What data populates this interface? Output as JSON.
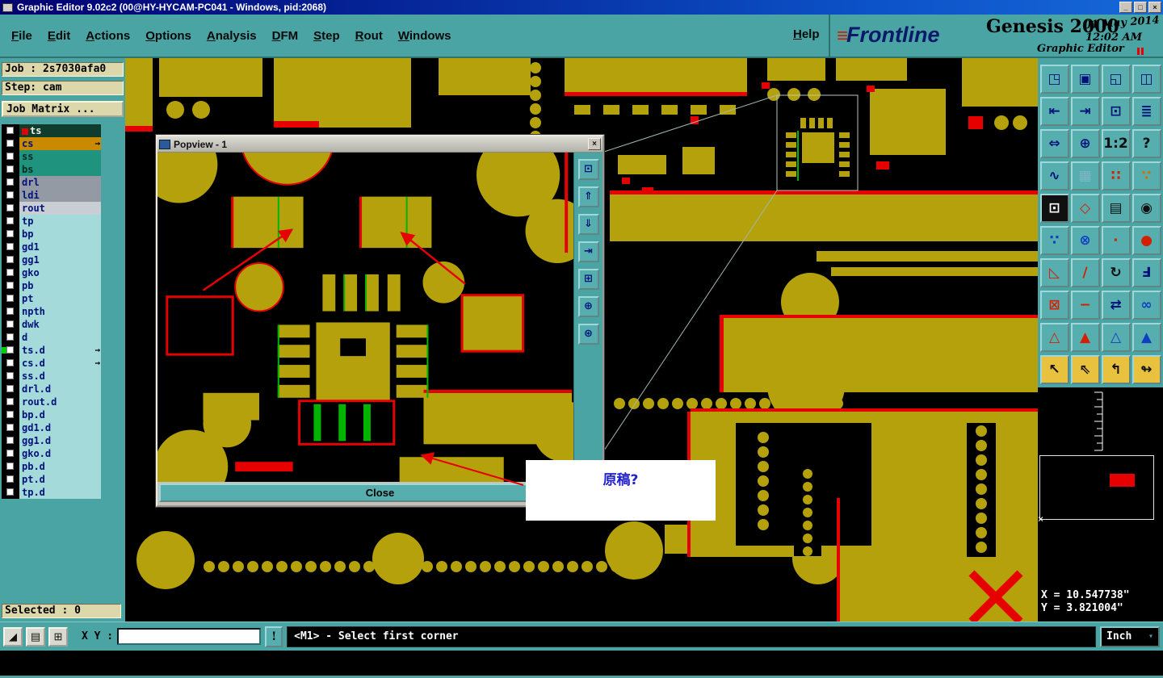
{
  "titlebar": {
    "title": "Graphic Editor 9.02c2 (00@HY-HYCAM-PC041 - Windows, pid:2068)",
    "minimize": "_",
    "maximize": "□",
    "close": "×"
  },
  "menubar": {
    "items": [
      "File",
      "Edit",
      "Actions",
      "Options",
      "Analysis",
      "DFM",
      "Step",
      "Rout",
      "Windows"
    ],
    "help": "Help"
  },
  "brand": {
    "logo_mark": "≡",
    "logo": "Frontline",
    "product": "Genesis 2000",
    "date": "01 May 2014",
    "time": "12:02 AM",
    "subtitle": "Graphic Editor"
  },
  "left_panel": {
    "job": "Job : 2s7030afa0",
    "step": "Step: cam",
    "matrix_button": "Job Matrix ...",
    "selected": "Selected : 0",
    "layers": [
      {
        "name": "ts",
        "bg": "#0e3d2e",
        "fg": "#f0f0e0",
        "swatch": "#e60000"
      },
      {
        "name": "cs",
        "bg": "#c98a00",
        "fg": "#00127a",
        "arrow": "→"
      },
      {
        "name": "ss",
        "bg": "#20937f",
        "fg": "#002a20"
      },
      {
        "name": "bs",
        "bg": "#20937f",
        "fg": "#002a20"
      },
      {
        "name": "drl",
        "bg": "#939aa4",
        "fg": "#00127a"
      },
      {
        "name": "ldi",
        "bg": "#939aa4",
        "fg": "#00127a"
      },
      {
        "name": "rout",
        "bg": "#c9ced4",
        "fg": "#00127a"
      },
      {
        "name": "tp",
        "bg": "#a5dada",
        "fg": "#00127a"
      },
      {
        "name": "bp",
        "bg": "#a5dada",
        "fg": "#00127a"
      },
      {
        "name": "gd1",
        "bg": "#a5dada",
        "fg": "#00127a"
      },
      {
        "name": "gg1",
        "bg": "#a5dada",
        "fg": "#00127a"
      },
      {
        "name": "gko",
        "bg": "#a5dada",
        "fg": "#00127a"
      },
      {
        "name": "pb",
        "bg": "#a5dada",
        "fg": "#00127a"
      },
      {
        "name": "pt",
        "bg": "#a5dada",
        "fg": "#00127a"
      },
      {
        "name": "npth",
        "bg": "#a5dada",
        "fg": "#00127a"
      },
      {
        "name": "dwk",
        "bg": "#a5dada",
        "fg": "#00127a"
      },
      {
        "name": "d",
        "bg": "#a5dada",
        "fg": "#00127a"
      },
      {
        "name": "ts.d",
        "bg": "#a5dada",
        "fg": "#00127a",
        "marker": "#00cc00",
        "arrow": "→"
      },
      {
        "name": "cs.d",
        "bg": "#a5dada",
        "fg": "#00127a",
        "arrow": "→"
      },
      {
        "name": "ss.d",
        "bg": "#a5dada",
        "fg": "#00127a"
      },
      {
        "name": "drl.d",
        "bg": "#a5dada",
        "fg": "#00127a"
      },
      {
        "name": "rout.d",
        "bg": "#a5dada",
        "fg": "#00127a"
      },
      {
        "name": "bp.d",
        "bg": "#a5dada",
        "fg": "#00127a"
      },
      {
        "name": "gd1.d",
        "bg": "#a5dada",
        "fg": "#00127a"
      },
      {
        "name": "gg1.d",
        "bg": "#a5dada",
        "fg": "#00127a"
      },
      {
        "name": "gko.d",
        "bg": "#a5dada",
        "fg": "#00127a"
      },
      {
        "name": "pb.d",
        "bg": "#a5dada",
        "fg": "#00127a"
      },
      {
        "name": "pt.d",
        "bg": "#a5dada",
        "fg": "#00127a"
      },
      {
        "name": "tp.d",
        "bg": "#a5dada",
        "fg": "#00127a"
      }
    ]
  },
  "right_toolbar": {
    "buttons": [
      {
        "name": "open-window-icon",
        "glyph": "◳",
        "color": "#00127a"
      },
      {
        "name": "monitor-icon",
        "glyph": "▣",
        "color": "#00127a"
      },
      {
        "name": "window-corner-icon",
        "glyph": "◱",
        "color": "#00127a"
      },
      {
        "name": "split-window-icon",
        "glyph": "◫",
        "color": "#00127a"
      },
      {
        "name": "pan-left-icon",
        "glyph": "⇤",
        "color": "#00127a"
      },
      {
        "name": "pan-right-icon",
        "glyph": "⇥",
        "color": "#00127a"
      },
      {
        "name": "zoom-window-icon",
        "glyph": "⊡",
        "color": "#00127a"
      },
      {
        "name": "layers-stack-icon",
        "glyph": "≣",
        "color": "#00127a"
      },
      {
        "name": "zoom-fit-icon",
        "glyph": "⇔",
        "color": "#00127a"
      },
      {
        "name": "zoom-center-icon",
        "glyph": "⊕",
        "color": "#00127a"
      },
      {
        "name": "zoom-1-2-icon",
        "glyph": "1:2",
        "color": "#101010"
      },
      {
        "name": "help-icon",
        "glyph": "?",
        "color": "#101010"
      },
      {
        "name": "probe-icon",
        "glyph": "∿",
        "color": "#00127a"
      },
      {
        "name": "grid-icon",
        "glyph": "▦",
        "color": "#7fb6c6"
      },
      {
        "name": "pad-pair-icon",
        "glyph": "∷",
        "color": "#d42000"
      },
      {
        "name": "pad-select-icon",
        "glyph": "∵",
        "color": "#d47000"
      },
      {
        "name": "clip-area-icon",
        "glyph": "⊡",
        "color": "#ffffff",
        "bg": "#101010"
      },
      {
        "name": "polygon-edit-icon",
        "glyph": "◇",
        "color": "#d42000"
      },
      {
        "name": "ruler-icon",
        "glyph": "▤",
        "color": "#101010"
      },
      {
        "name": "filled-pad-icon",
        "glyph": "◉",
        "color": "#101010"
      },
      {
        "name": "two-points-icon",
        "glyph": "∵",
        "color": "#1040c0"
      },
      {
        "name": "delete-cross-icon",
        "glyph": "⊗",
        "color": "#1040c0"
      },
      {
        "name": "small-pad-icon",
        "glyph": "∙",
        "color": "#d42000"
      },
      {
        "name": "large-pad-icon",
        "glyph": "●",
        "color": "#d42000"
      },
      {
        "name": "angle-tool-icon",
        "glyph": "◺",
        "color": "#d42000"
      },
      {
        "name": "slope-tool-icon",
        "glyph": "∕",
        "color": "#d42000"
      },
      {
        "name": "rotate-icon",
        "glyph": "↻",
        "color": "#101010"
      },
      {
        "name": "mirror-icon",
        "glyph": "Ⅎ",
        "color": "#00127a"
      },
      {
        "name": "swap-pad-icon",
        "glyph": "⊠",
        "color": "#d42000"
      },
      {
        "name": "line-width-icon",
        "glyph": "−",
        "color": "#d42000"
      },
      {
        "name": "transfer-icon",
        "glyph": "⇄",
        "color": "#00127a"
      },
      {
        "name": "linked-pads-icon",
        "glyph": "∞",
        "color": "#1040c0"
      },
      {
        "name": "triangle-outline-icon",
        "glyph": "△",
        "color": "#d42000"
      },
      {
        "name": "triangle-filled-icon",
        "glyph": "▲",
        "color": "#d42000"
      },
      {
        "name": "triangle-outline-blue-icon",
        "glyph": "△",
        "color": "#1040c0"
      },
      {
        "name": "triangle-filled-blue-icon",
        "glyph": "▲",
        "color": "#1040c0"
      },
      {
        "name": "select-pointer-icon",
        "glyph": "↖",
        "color": "#101010",
        "bg": "#e8c23e"
      },
      {
        "name": "select-add-icon",
        "glyph": "⇖",
        "color": "#101010",
        "bg": "#e8c23e"
      },
      {
        "name": "select-frame-icon",
        "glyph": "↰",
        "color": "#101010",
        "bg": "#e8c23e"
      },
      {
        "name": "select-net-icon",
        "glyph": "↬",
        "color": "#101010",
        "bg": "#e8c23e"
      }
    ]
  },
  "popview": {
    "title": "Popview - 1",
    "close_x": "×",
    "close_button": "Close",
    "tools": [
      {
        "name": "popview-frame-icon",
        "glyph": "⊡"
      },
      {
        "name": "popview-up-icon",
        "glyph": "⇑"
      },
      {
        "name": "popview-down-icon",
        "glyph": "⇓"
      },
      {
        "name": "popview-pan-icon",
        "glyph": "⇥"
      },
      {
        "name": "popview-tile-icon",
        "glyph": "⊞"
      },
      {
        "name": "popview-center-icon",
        "glyph": "⊕"
      },
      {
        "name": "popview-zoom-icon",
        "glyph": "⊛"
      }
    ]
  },
  "annotation": {
    "text": "原稿?"
  },
  "coords": {
    "x": "X = 10.547738\"",
    "y": "Y = 3.821004\""
  },
  "statusbar": {
    "xy_label": "X Y :",
    "xy_value": "",
    "bang": "!",
    "message": "<M1> - Select first corner",
    "units": "Inch",
    "units_caret": "▾",
    "tools": [
      {
        "name": "corner-select-icon",
        "glyph": "◢"
      },
      {
        "name": "table-mode-icon",
        "glyph": "▤"
      },
      {
        "name": "grid-toggle-icon",
        "glyph": "⊞"
      }
    ]
  },
  "colors": {
    "copper": "#b5a10c",
    "outline_red": "#e60000",
    "trace_green": "#00b400",
    "canvas_bg": "#000000",
    "ui_teal": "#4ba4a4",
    "title_blue": "#000080",
    "panel_beige": "#ddd8ac"
  }
}
